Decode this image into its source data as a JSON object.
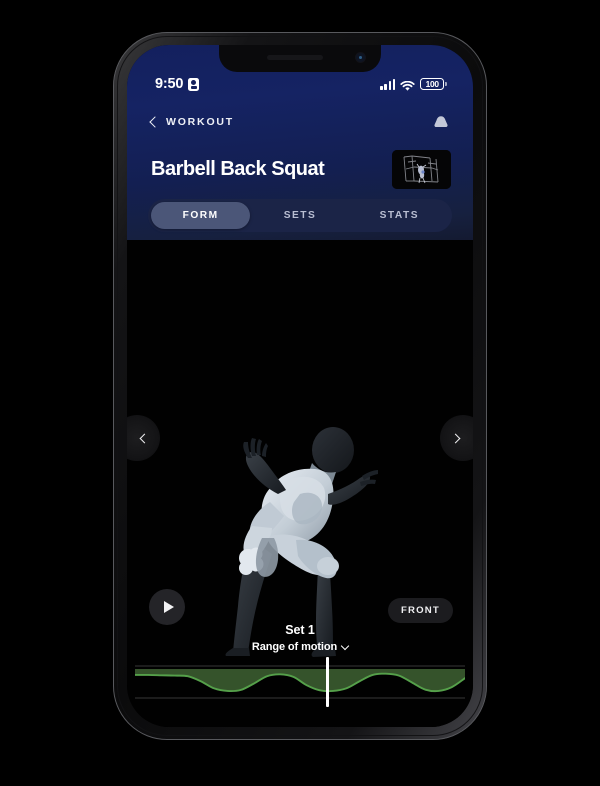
{
  "status_bar": {
    "time": "9:50",
    "recording_icon": "recording-indicator-icon",
    "signal_icon": "cellular-signal-icon",
    "wifi_icon": "wifi-icon",
    "battery_level": "100"
  },
  "nav": {
    "back_icon": "chevron-left-icon",
    "back_label": "WORKOUT",
    "cloud_icon": "cloud-sync-icon"
  },
  "header": {
    "title": "Barbell Back Squat",
    "thumbnail_name": "exercise-thumbnail"
  },
  "tabs": [
    {
      "label": "FORM",
      "active": true
    },
    {
      "label": "SETS",
      "active": false
    },
    {
      "label": "STATS",
      "active": false
    }
  ],
  "viewer": {
    "prev_icon": "chevron-left-icon",
    "next_icon": "chevron-right-icon",
    "play_icon": "play-icon",
    "camera_view_label": "FRONT",
    "model_name": "3d-body-model"
  },
  "set_panel": {
    "set_title": "Set 1",
    "metric_label": "Range of motion",
    "metric_chevron_icon": "chevron-down-icon"
  },
  "colors": {
    "header_navy": "#13205e",
    "tabbar_bg": "#1b2447",
    "tab_active_bg": "#4b5678",
    "waveform_line": "#55a04a",
    "waveform_fill": "#35532b",
    "playhead": "#ffffff",
    "screen_bg": "#010101"
  },
  "chart_data": {
    "type": "area",
    "title": "Range of motion",
    "xlabel": "",
    "ylabel": "",
    "grid": true,
    "legend": "none",
    "line_color": "#55a04a",
    "fill_color": "#35532b",
    "ylim": [
      0,
      100
    ],
    "playhead_position_pct": 58,
    "x": [
      0,
      4,
      8,
      12,
      16,
      20,
      24,
      28,
      32,
      36,
      40,
      44,
      48,
      52,
      56,
      60,
      64,
      68,
      72,
      76,
      80,
      84,
      88,
      92,
      96,
      100
    ],
    "values": [
      72,
      72,
      71,
      70,
      68,
      52,
      30,
      22,
      25,
      45,
      68,
      74,
      66,
      40,
      24,
      22,
      30,
      52,
      72,
      76,
      70,
      48,
      26,
      22,
      34,
      62
    ]
  }
}
